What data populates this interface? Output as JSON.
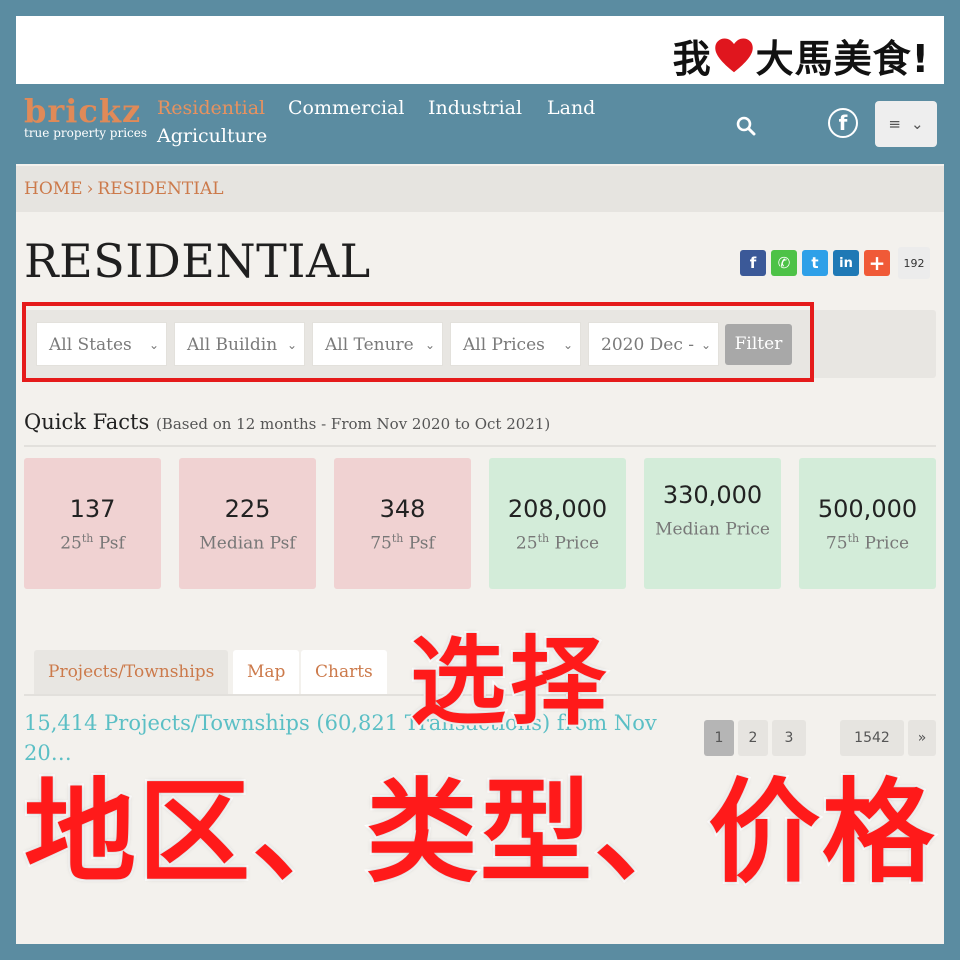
{
  "banner": {
    "text_left": "我",
    "text_right": "大馬美食!"
  },
  "logo": {
    "name": "brickz",
    "tagline": "true property prices"
  },
  "nav": {
    "items": [
      "Residential",
      "Commercial",
      "Industrial",
      "Land",
      "Agriculture"
    ],
    "active": "Residential",
    "menu_icon": "≡"
  },
  "breadcrumb": {
    "home": "HOME",
    "separator": "›",
    "current": "RESIDENTIAL"
  },
  "page_title": "RESIDENTIAL",
  "share": {
    "facebook": "f",
    "whatsapp": "✆",
    "twitter": "t",
    "linkedin": "in",
    "more": "+",
    "count": "192"
  },
  "filters": {
    "state": "All States",
    "building": "All Buildin",
    "tenure": "All Tenure",
    "price": "All Prices",
    "period": "2020 Dec -",
    "button": "Filter"
  },
  "quick_facts": {
    "title": "Quick Facts",
    "subtitle": "(Based on 12 months - From Nov 2020 to Oct 2021)",
    "items": [
      {
        "value": "137",
        "label_pre": "25",
        "label_sup": "th",
        "label_post": " Psf"
      },
      {
        "value": "225",
        "label_pre": "Median Psf",
        "label_sup": "",
        "label_post": ""
      },
      {
        "value": "348",
        "label_pre": "75",
        "label_sup": "th",
        "label_post": " Psf"
      },
      {
        "value": "208,000",
        "label_pre": "25",
        "label_sup": "th",
        "label_post": " Price"
      },
      {
        "value": "330,000",
        "label_pre": "Median Price",
        "label_sup": "",
        "label_post": ""
      },
      {
        "value": "500,000",
        "label_pre": "75",
        "label_sup": "th",
        "label_post": " Price"
      }
    ]
  },
  "tabs": [
    "Projects/Townships",
    "Map",
    "Charts"
  ],
  "summary": "15,414 Projects/Townships (60,821 Transactions) from Nov 20…",
  "pagination": [
    "1",
    "2",
    "3",
    "1542",
    "»"
  ],
  "overlay": {
    "line1": "选择",
    "line2": "地区、类型、价格"
  },
  "colors": {
    "brand_orange": "#e08a58",
    "nav_bg": "#5b8ca1",
    "highlight_red": "#e51b1b",
    "teal_text": "#5bbfc5"
  }
}
